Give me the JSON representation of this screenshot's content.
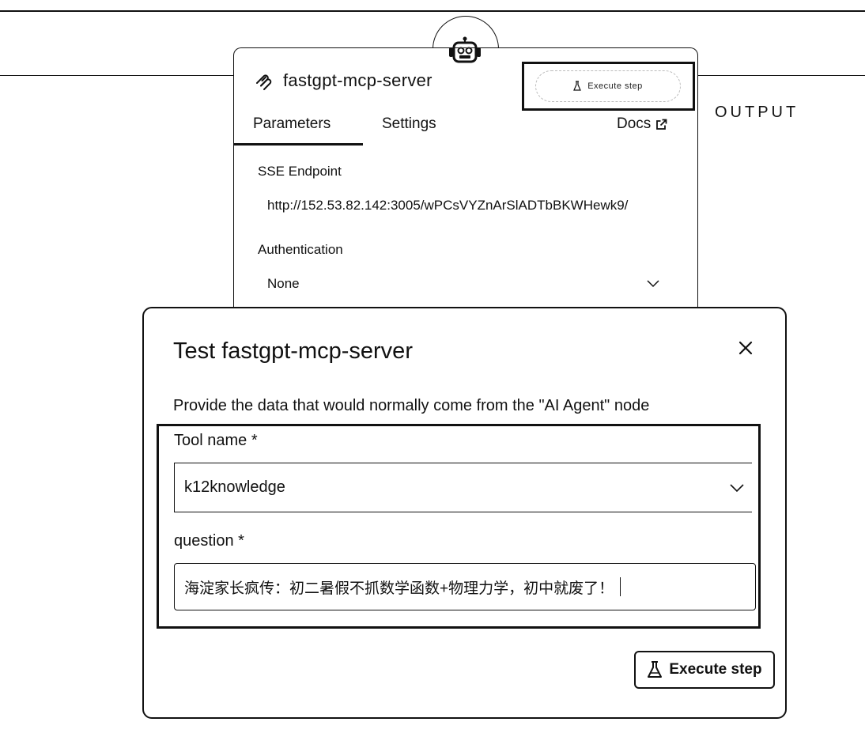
{
  "node": {
    "title": "fastgpt-mcp-server",
    "tabs": [
      {
        "label": "Parameters"
      },
      {
        "label": "Settings"
      }
    ],
    "docs_label": "Docs",
    "mini_execute_label": "Execute step",
    "output_label": "OUTPUT",
    "fields": {
      "sse_label": "SSE Endpoint",
      "sse_value": "http://152.53.82.142:3005/wPCsVYZnArSlADTbBKWHewk9/",
      "auth_label": "Authentication",
      "auth_value": "None"
    }
  },
  "modal": {
    "title": "Test fastgpt-mcp-server",
    "description": "Provide the data that would normally come from the \"AI Agent\" node",
    "tool_label": "Tool name *",
    "tool_value": "k12knowledge",
    "question_label": "question *",
    "question_value": "海淀家长疯传：初二暑假不抓数学函数+物理力学，初中就废了！",
    "execute_label": "Execute step"
  },
  "icons": {
    "node_icon": "mcp-icon",
    "robot": "robot-icon",
    "docs": "external-link-icon",
    "close": "close-icon",
    "chevron": "chevron-down-icon",
    "flask": "flask-icon"
  }
}
